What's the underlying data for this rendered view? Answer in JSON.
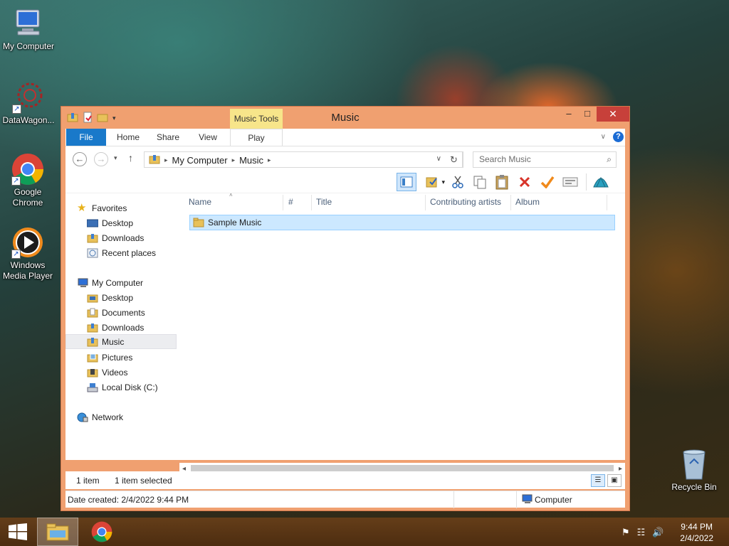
{
  "desktop": {
    "icons": [
      {
        "label": "My Computer"
      },
      {
        "label": "DataWagon..."
      },
      {
        "label": "Google\nChrome",
        "line1": "Google",
        "line2": "Chrome"
      },
      {
        "label": "Windows Media Player",
        "line1": "Windows",
        "line2": "Media Player"
      },
      {
        "label": "Recycle Bin"
      }
    ]
  },
  "window": {
    "title": "Music",
    "context_tab_group": "Music Tools",
    "ribbon_tabs": [
      "File",
      "Home",
      "Share",
      "View",
      "Play"
    ],
    "address": {
      "crumbs": [
        "My Computer",
        "Music"
      ]
    },
    "search_placeholder": "Search Music",
    "nav": {
      "favorites_header": "Favorites",
      "favorites": [
        "Desktop",
        "Downloads",
        "Recent places"
      ],
      "computer_header": "My Computer",
      "computer": [
        "Desktop",
        "Documents",
        "Downloads",
        "Music",
        "Pictures",
        "Videos",
        "Local Disk (C:)"
      ],
      "selected": "Music",
      "network": "Network"
    },
    "columns": [
      "Name",
      "#",
      "Title",
      "Contributing artists",
      "Album"
    ],
    "rows": [
      {
        "name": "Sample Music",
        "selected": true
      }
    ],
    "status": {
      "count": "1 item",
      "selection": "1 item selected"
    },
    "details": {
      "date_created": "Date created: 2/4/2022 9:44 PM",
      "location": "Computer"
    }
  },
  "taskbar": {
    "clock_time": "9:44 PM",
    "clock_date": "2/4/2022"
  },
  "colors": {
    "file_tab": "#1979ca",
    "window_border": "#f0a070",
    "selection": "#cce8ff",
    "context_tab": "#f7e58a"
  }
}
